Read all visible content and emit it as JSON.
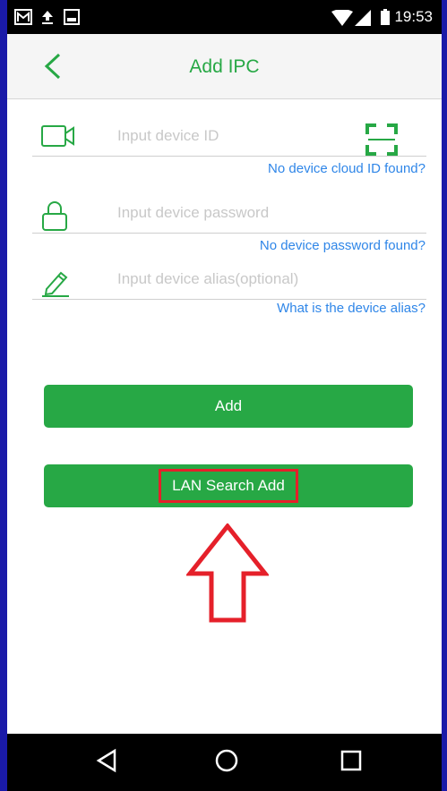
{
  "status_bar": {
    "time": "19:53",
    "icons": [
      "gmail-icon",
      "upload-icon",
      "image-icon",
      "wifi-icon",
      "signal-icon",
      "battery-icon"
    ]
  },
  "header": {
    "title": "Add IPC",
    "back_icon": "chevron-left-icon"
  },
  "form": {
    "device_id": {
      "placeholder": "Input device ID",
      "icon": "camera-icon",
      "help_link": "No device cloud ID found?"
    },
    "scan_icon": "qr-scan-icon",
    "password": {
      "placeholder": "Input device password",
      "icon": "lock-icon",
      "help_link": "No device password found?"
    },
    "alias": {
      "placeholder": "Input device alias(optional)",
      "icon": "pencil-icon",
      "help_link": "What is the device alias?"
    }
  },
  "buttons": {
    "add_label": "Add",
    "lan_search_label": "LAN Search Add"
  },
  "colors": {
    "accent": "#27a845",
    "link": "#2f86e8",
    "highlight": "#e5202a"
  },
  "nav_bar": {
    "icons": [
      "back-triangle-icon",
      "home-circle-icon",
      "recents-square-icon"
    ]
  }
}
